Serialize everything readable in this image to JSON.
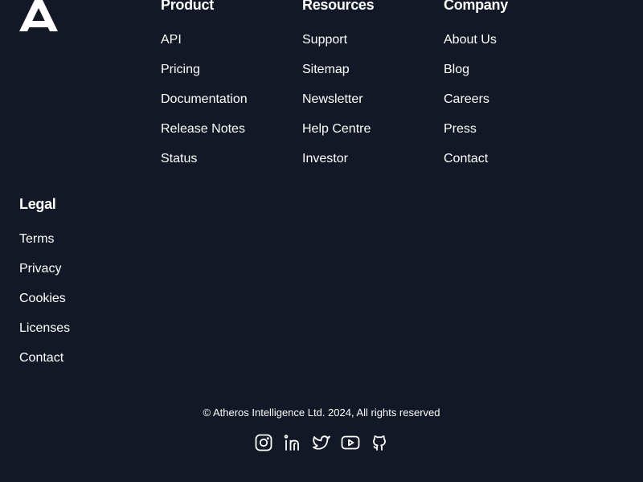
{
  "brand": {
    "logo_icon": "atheros-logo-icon",
    "background_color": "#121826",
    "text_color": "#ffffff"
  },
  "columns": {
    "product": {
      "title": "Product",
      "items": [
        "API",
        "Pricing",
        "Documentation",
        "Release Notes",
        "Status"
      ]
    },
    "resources": {
      "title": "Resources",
      "items": [
        "Support",
        "Sitemap",
        "Newsletter",
        "Help Centre",
        "Investor"
      ]
    },
    "company": {
      "title": "Company",
      "items": [
        "About Us",
        "Blog",
        "Careers",
        "Press",
        "Contact"
      ]
    },
    "legal": {
      "title": "Legal",
      "items": [
        "Terms",
        "Privacy",
        "Cookies",
        "Licenses",
        "Contact"
      ]
    }
  },
  "footer": {
    "copyright": "© Atheros Intelligence Ltd. 2024, All rights reserved",
    "social_icons": [
      "instagram-icon",
      "linkedin-icon",
      "twitter-icon",
      "youtube-icon",
      "github-icon"
    ]
  }
}
